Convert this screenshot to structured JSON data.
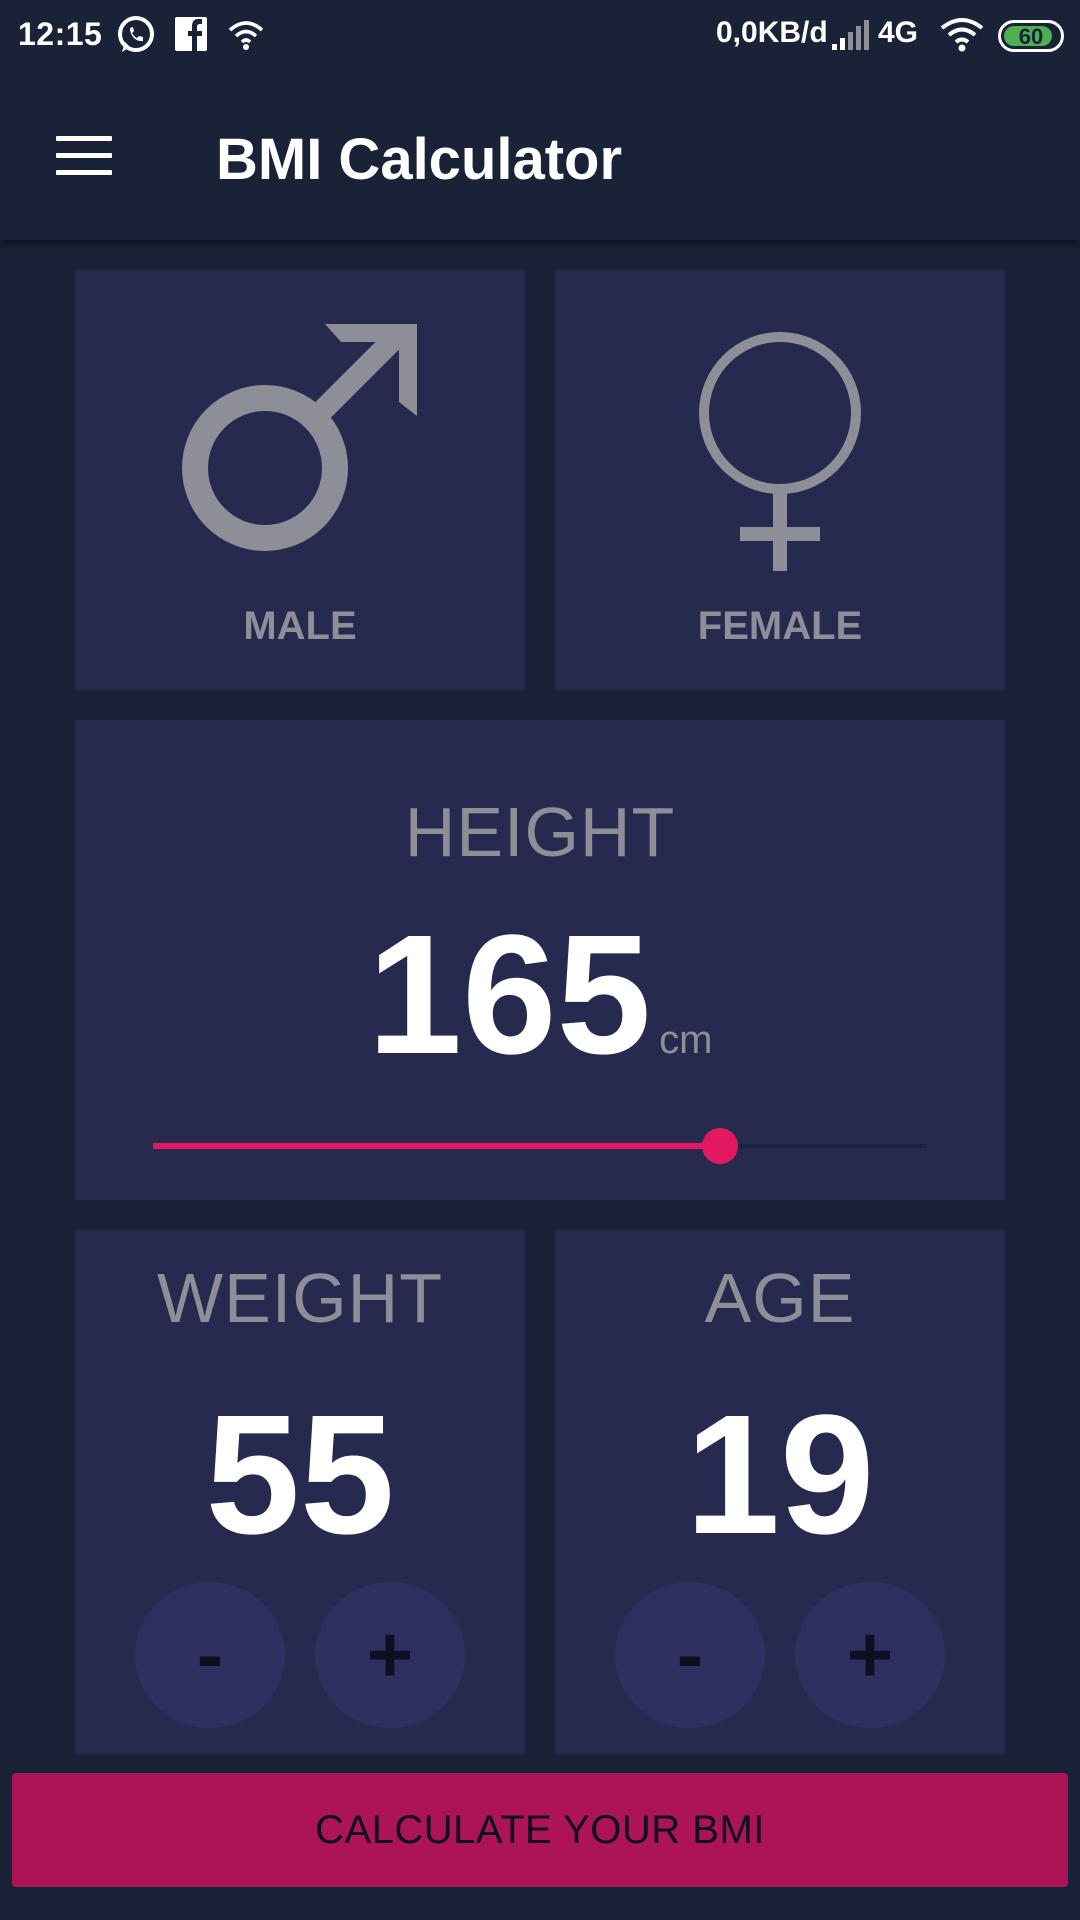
{
  "status_bar": {
    "time": "12:15",
    "data_rate": "0,0KB/d",
    "network": "4G",
    "battery": "60",
    "battery_color": "#4caf50"
  },
  "app_bar": {
    "title": "BMI Calculator",
    "menu_icon": "hamburger-menu-icon"
  },
  "gender": {
    "male_label": "MALE",
    "female_label": "FEMALE",
    "male_icon": "male-symbol-icon",
    "female_icon": "female-symbol-icon"
  },
  "height": {
    "label": "HEIGHT",
    "value": "165",
    "unit": "cm",
    "slider_fraction": 0.733
  },
  "weight": {
    "label": "WEIGHT",
    "value": "55",
    "minus_label": "-",
    "plus_label": "+"
  },
  "age": {
    "label": "AGE",
    "value": "19",
    "minus_label": "-",
    "plus_label": "+"
  },
  "calculate_button": {
    "label": "CALCULATE YOUR BMI"
  },
  "colors": {
    "background": "#1a2238",
    "card": "#272a4f",
    "accent": "#e2195f",
    "button": "#ad1457",
    "label": "#8d8e98"
  }
}
